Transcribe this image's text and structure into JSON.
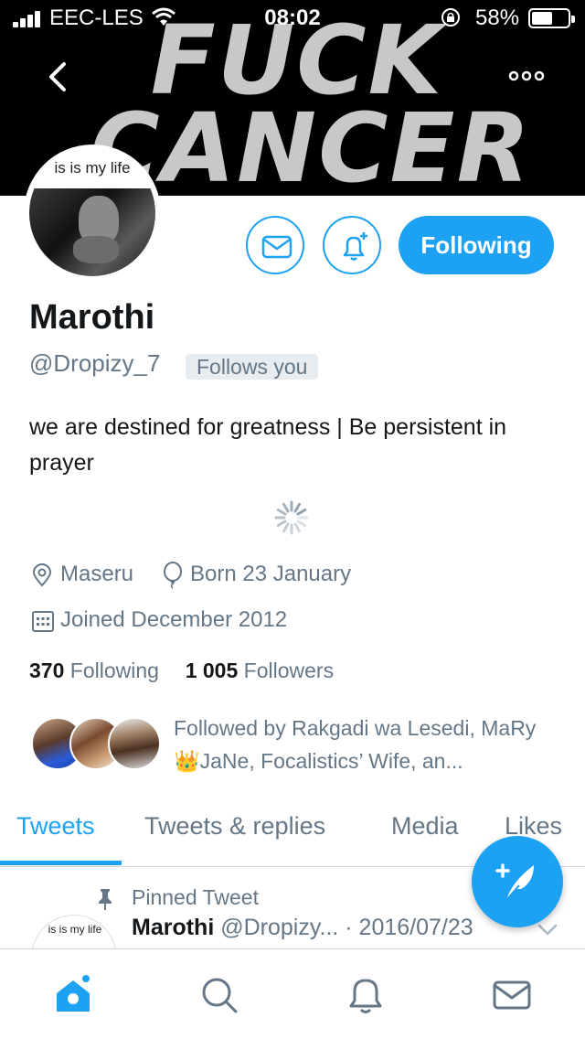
{
  "status_bar": {
    "carrier": "EEC-LES",
    "time": "08:02",
    "battery_percent": "58%",
    "battery_level": 0.58,
    "icons": [
      "signal-icon",
      "wifi-icon",
      "orientation-lock-icon",
      "battery-icon"
    ]
  },
  "header": {
    "banner_text_line1": "FUCK",
    "banner_text_line2": "CANCER",
    "back_icon": "chevron-left-icon",
    "more_icon": "more-horizontal-icon"
  },
  "avatar": {
    "caption": "is is my life"
  },
  "actions": {
    "message_icon": "envelope-icon",
    "notify_icon": "bell-plus-icon",
    "following_label": "Following"
  },
  "profile": {
    "name": "Marothi",
    "handle": "@Dropizy_7",
    "follows_you": "Follows you",
    "bio": "we are destined for greatness | Be persistent in prayer",
    "location": "Maseru",
    "birthday": "Born 23 January",
    "joined": "Joined December 2012",
    "following_count": "370",
    "following_label": "Following",
    "followers_count": "1 005",
    "followers_label": "Followers",
    "followed_by": "Followed by Rakgadi wa Lesedi, MaRy👑JaNe, Focalistics’ Wife, an..."
  },
  "tabs": [
    {
      "label": "Tweets",
      "active": true
    },
    {
      "label": "Tweets & replies",
      "active": false
    },
    {
      "label": "Media",
      "active": false
    },
    {
      "label": "Likes",
      "active": false
    }
  ],
  "pinned_tweet": {
    "label": "Pinned Tweet",
    "avatar_caption": "is is my life",
    "name": "Marothi",
    "handle_date": "@Dropizy... · 2016/07/23"
  },
  "fab": {
    "icon": "compose-tweet-icon"
  },
  "bottom_nav": [
    {
      "icon": "home-icon",
      "active": true
    },
    {
      "icon": "search-icon",
      "active": false
    },
    {
      "icon": "notifications-icon",
      "active": false
    },
    {
      "icon": "messages-icon",
      "active": false
    }
  ],
  "colors": {
    "accent": "#1da1f2",
    "text_primary": "#14171a",
    "text_secondary": "#657786"
  }
}
